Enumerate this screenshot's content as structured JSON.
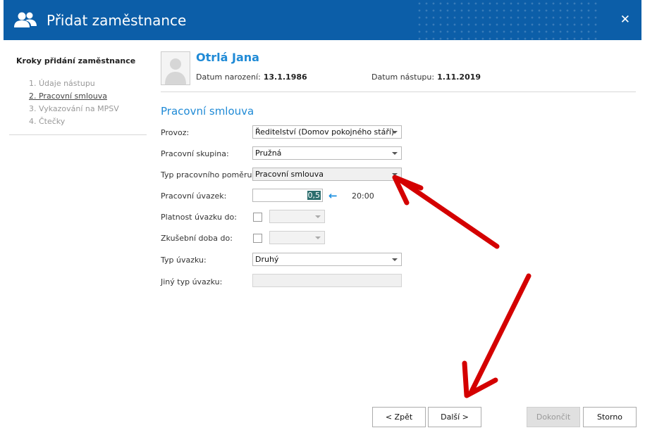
{
  "window": {
    "title": "Přidat zaměstnance",
    "close_label": "✕"
  },
  "steps": {
    "title": "Kroky přidání zaměstnance",
    "items": [
      "1. Údaje nástupu",
      "2. Pracovní smlouva",
      "3. Vykazování na MPSV",
      "4. Čtečky"
    ]
  },
  "employee": {
    "name": "Otrlá Jana",
    "birth_label": "Datum narození:",
    "birth_value": "13.1.1986",
    "start_label": "Datum nástupu:",
    "start_value": "1.11.2019"
  },
  "section_title": "Pracovní smlouva",
  "form": {
    "provoz": {
      "label": "Provoz:",
      "value": "Ředitelství (Domov pokojného stáří)"
    },
    "skupina": {
      "label": "Pracovní skupina:",
      "value": "Pružná"
    },
    "typ_pomeru": {
      "label": "Typ pracovního poměru:",
      "value": "Pracovní smlouva"
    },
    "uvazek": {
      "label": "Pracovní úvazek:",
      "value": "0,5",
      "arrow": "←",
      "hours": "20:00"
    },
    "platnost": {
      "label": "Platnost úvazku do:"
    },
    "zkusebni": {
      "label": "Zkušební doba do:"
    },
    "typ_uvazku": {
      "label": "Typ úvazku:",
      "value": "Druhý"
    },
    "jiny_typ": {
      "label": "Jiný typ úvazku:"
    }
  },
  "buttons": {
    "back": "< Zpět",
    "next": "Další >",
    "finish": "Dokončit",
    "cancel": "Storno"
  },
  "colors": {
    "titlebar": "#0c5ea8",
    "accent": "#1f8ad6",
    "annotation_arrow": "#dd0000"
  }
}
